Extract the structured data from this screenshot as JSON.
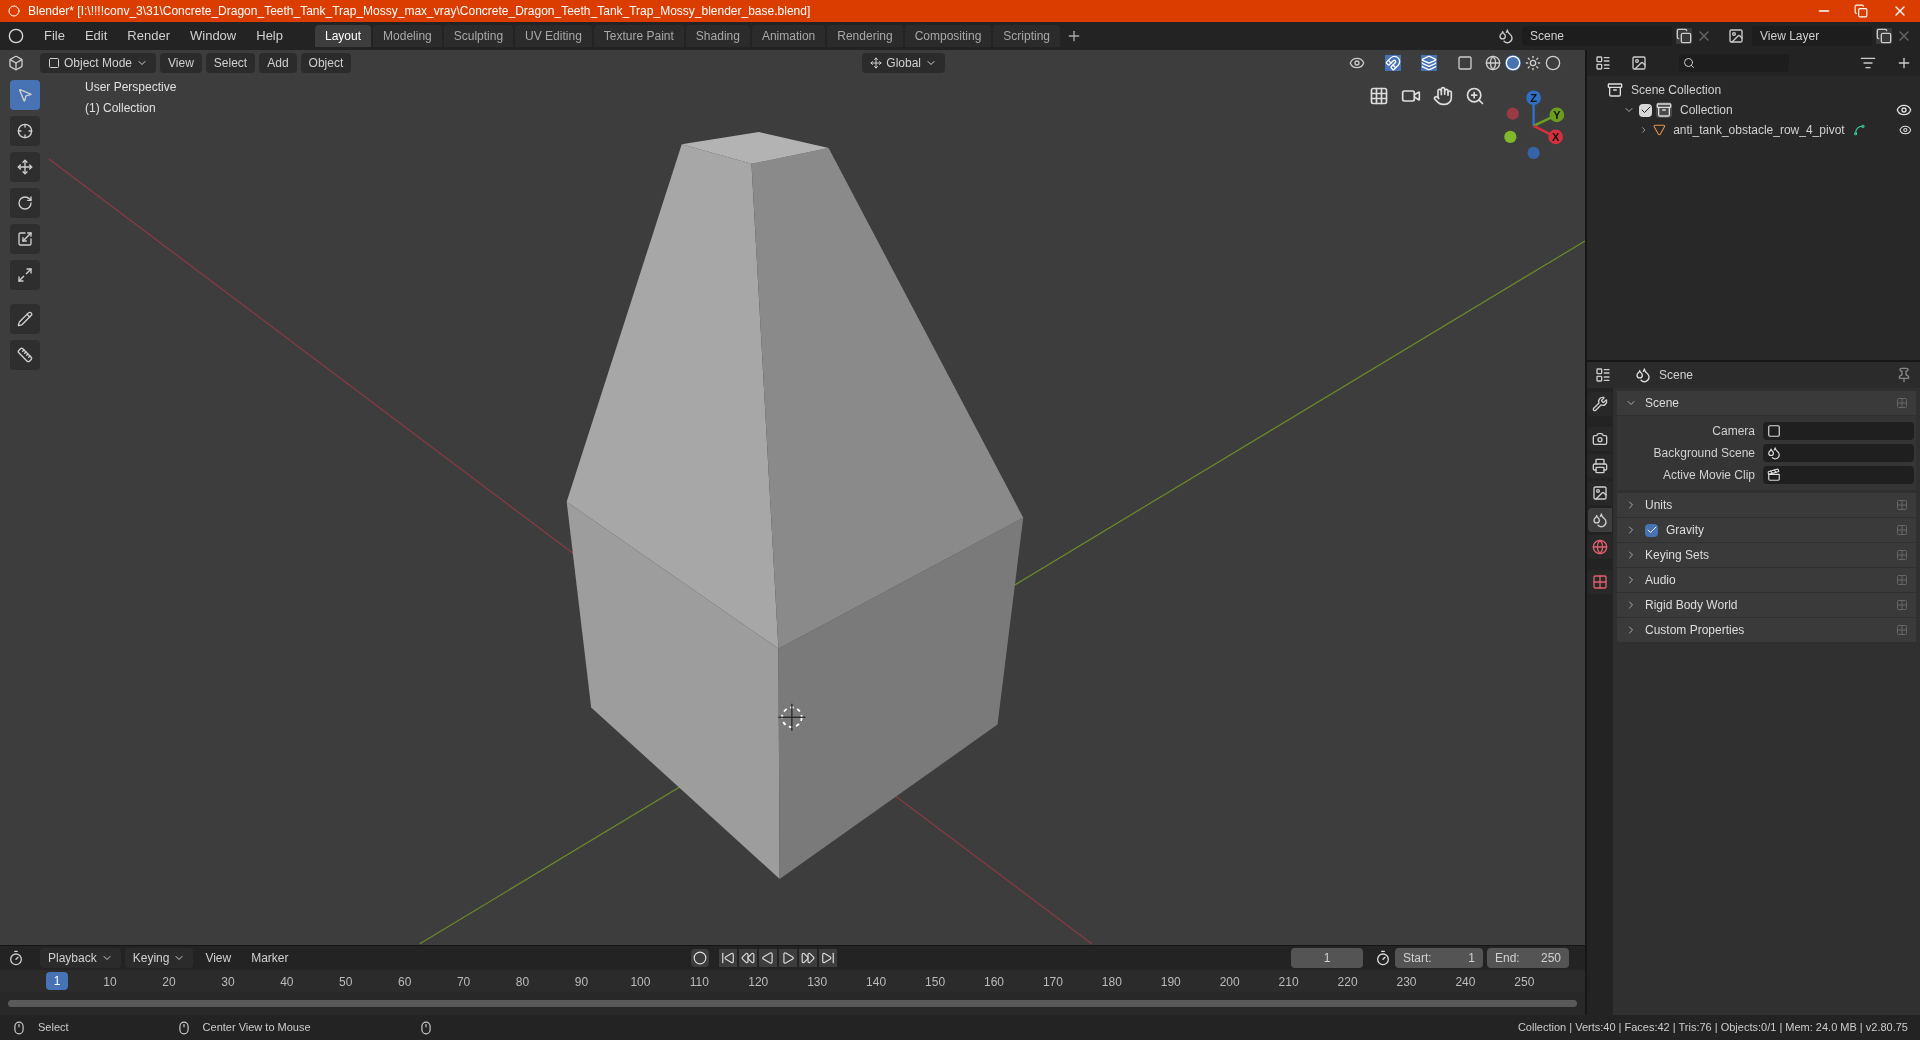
{
  "window": {
    "title": "Blender* [I:\\!!!!conv_3\\31\\Concrete_Dragon_Teeth_Tank_Trap_Mossy_max_vray\\Concrete_Dragon_Teeth_Tank_Trap_Mossy_blender_base.blend]"
  },
  "menu": [
    "File",
    "Edit",
    "Render",
    "Window",
    "Help"
  ],
  "workspaces": [
    {
      "label": "Layout",
      "selected": true
    },
    {
      "label": "Modeling",
      "selected": false
    },
    {
      "label": "Sculpting",
      "selected": false
    },
    {
      "label": "UV Editing",
      "selected": false
    },
    {
      "label": "Texture Paint",
      "selected": false
    },
    {
      "label": "Shading",
      "selected": false
    },
    {
      "label": "Animation",
      "selected": false
    },
    {
      "label": "Rendering",
      "selected": false
    },
    {
      "label": "Compositing",
      "selected": false
    },
    {
      "label": "Scripting",
      "selected": false
    }
  ],
  "scene_selector": {
    "value": "Scene"
  },
  "view_layer": {
    "value": "View Layer"
  },
  "viewport": {
    "mode": "Object Mode",
    "menus": [
      "View",
      "Select",
      "Add",
      "Object"
    ],
    "orientation": "Global",
    "view_name": "User Perspective",
    "collection_label": "(1) Collection",
    "tools": [
      {
        "kind": "select",
        "selected": true
      },
      {
        "kind": "cursor",
        "selected": false
      },
      {
        "kind": "move",
        "selected": false
      },
      {
        "kind": "rotate",
        "selected": false
      },
      {
        "kind": "scale",
        "selected": false
      },
      {
        "kind": "transform",
        "selected": false
      },
      {
        "kind": "annotate",
        "selected": false
      },
      {
        "kind": "measure",
        "selected": false
      }
    ],
    "gizmo_axes": [
      {
        "label": "Z",
        "color": "#2f6fc6"
      },
      {
        "label": "Y",
        "color": "#6b9e1f"
      },
      {
        "label": "X",
        "color": "#d6303f"
      }
    ]
  },
  "outliner": {
    "items": [
      {
        "label": "Scene Collection",
        "kind": "scene",
        "children": [
          {
            "label": "Collection",
            "kind": "collection",
            "expanded": true,
            "checked": true,
            "children": [
              {
                "label": "anti_tank_obstacle_row_4_pivot",
                "kind": "object",
                "expanded": false
              }
            ]
          }
        ]
      }
    ]
  },
  "properties": {
    "title": "Scene",
    "tabs": [
      {
        "kind": "tool",
        "selected": false
      },
      {
        "kind": "render",
        "selected": false
      },
      {
        "kind": "output",
        "selected": false
      },
      {
        "kind": "view_layer",
        "selected": false
      },
      {
        "kind": "scene",
        "selected": true
      },
      {
        "kind": "world",
        "selected": false
      },
      {
        "kind": "texture",
        "selected": false
      }
    ],
    "sections": [
      {
        "label": "Scene",
        "kind": "panel",
        "expanded": true,
        "fields": [
          {
            "label": "Camera",
            "kind": "camera"
          },
          {
            "label": "Background Scene",
            "kind": "scene"
          },
          {
            "label": "Active Movie Clip",
            "kind": "clip"
          }
        ]
      },
      {
        "label": "Units",
        "kind": "panel",
        "expanded": false
      },
      {
        "label": "Gravity",
        "kind": "checkbox",
        "expanded": false,
        "checked": true
      },
      {
        "label": "Keying Sets",
        "kind": "panel",
        "expanded": false
      },
      {
        "label": "Audio",
        "kind": "panel",
        "expanded": false
      },
      {
        "label": "Rigid Body World",
        "kind": "panel",
        "expanded": false
      },
      {
        "label": "Custom Properties",
        "kind": "panel",
        "expanded": false
      }
    ]
  },
  "timeline": {
    "menus": [
      {
        "label": "Playback",
        "dropdown": true
      },
      {
        "label": "Keying",
        "dropdown": true
      },
      {
        "label": "View",
        "dropdown": false
      },
      {
        "label": "Marker",
        "dropdown": false
      }
    ],
    "current_frame": "1",
    "start_label": "Start:",
    "start": "1",
    "end_label": "End:",
    "end": "250",
    "playhead": "1",
    "ticks": [
      "10",
      "20",
      "30",
      "40",
      "50",
      "60",
      "70",
      "80",
      "90",
      "100",
      "110",
      "120",
      "130",
      "140",
      "150",
      "160",
      "170",
      "180",
      "190",
      "200",
      "210",
      "220",
      "230",
      "240",
      "250"
    ]
  },
  "status_bar": {
    "hints": [
      "Select",
      "Center View to Mouse"
    ],
    "stats": "Collection | Verts:40 | Faces:42 | Tris:76 | Objects:0/1 | Mem: 24.0 MB | v2.80.75"
  }
}
